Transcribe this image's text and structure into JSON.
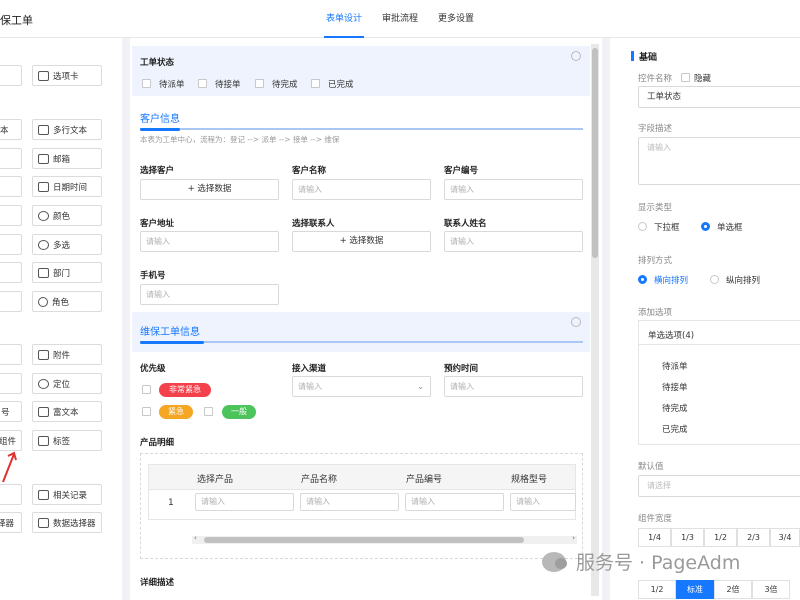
{
  "app_title": "保工单",
  "tabs": [
    "表单设计",
    "审批流程",
    "更多设置"
  ],
  "left_panel": {
    "col_b": [
      "选项卡",
      "多行文本",
      "邮箱",
      "日期时间",
      "颜色",
      "多选",
      "部门",
      "角色",
      "附件",
      "定位",
      "富文本",
      "标签",
      "相关记录",
      "数据选择器"
    ],
    "col_a": [
      "本",
      "号",
      "组件",
      "择器"
    ]
  },
  "form": {
    "status_label": "工单状态",
    "status_options": [
      "待派单",
      "待接单",
      "待完成",
      "已完成"
    ],
    "customer_section": "客户信息",
    "customer_note": "本表为工单中心，流程为：登记 --> 派单 --> 接单 --> 维保",
    "select_customer": "选择客户",
    "select_data_btn": "+ 选择数据",
    "customer_name": "客户名称",
    "customer_no": "客户编号",
    "customer_addr": "客户地址",
    "select_contact": "选择联系人",
    "contact_name": "联系人姓名",
    "phone": "手机号",
    "placeholder": "请输入",
    "maint_section": "维保工单信息",
    "priority": "优先级",
    "priority_tags": [
      "非常紧急",
      "紧急",
      "一般"
    ],
    "channel": "接入渠道",
    "appointment": "预约时间",
    "product_detail": "产品明细",
    "table_headers": [
      "选择产品",
      "产品名称",
      "产品编号",
      "规格型号"
    ],
    "row_index": "1",
    "detail_desc": "详细描述"
  },
  "right_panel": {
    "section": "基础",
    "widget_name": "控件名称",
    "hide": "隐藏",
    "widget_value": "工单状态",
    "field_desc": "字段描述",
    "desc_placeholder": "请输入",
    "display_type": "显示类型",
    "display_opts": [
      "下拉框",
      "单选框"
    ],
    "arrange": "排列方式",
    "arrange_opts": [
      "横向排列",
      "纵向排列"
    ],
    "add_options": "添加选项",
    "radio_group": "单选选项(4)",
    "options": [
      "待派单",
      "待接单",
      "待完成",
      "已完成"
    ],
    "default_value": "默认值",
    "default_placeholder": "请选择",
    "width_label": "组件宽度",
    "width_opts": [
      "1/4",
      "1/3",
      "1/2",
      "2/3",
      "3/4"
    ],
    "width2_opts": [
      "1/2",
      "标准",
      "2倍",
      "3倍"
    ]
  },
  "watermark": "服务号 · PageAdm",
  "colors": {
    "accent": "#1677ff",
    "tag_red": "#f5414b",
    "tag_orange": "#f5a623",
    "tag_green": "#4cc35b"
  }
}
